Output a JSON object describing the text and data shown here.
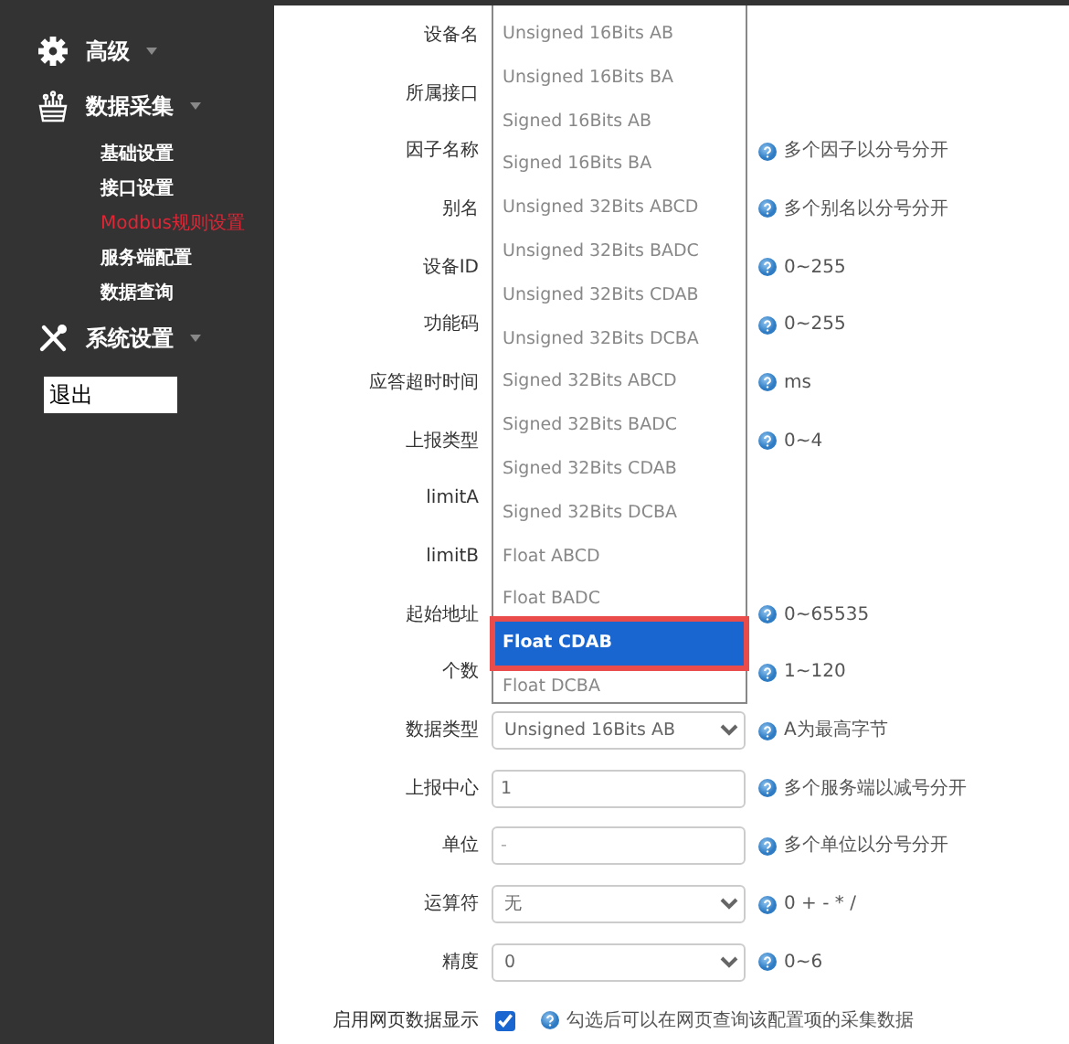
{
  "sidebar": {
    "items": [
      {
        "label": "高级",
        "kind": "gear"
      },
      {
        "label": "数据采集",
        "kind": "basket",
        "children": [
          {
            "label": "基础设置",
            "selected": false
          },
          {
            "label": "接口设置",
            "selected": false
          },
          {
            "label": "Modbus规则设置",
            "selected": true
          },
          {
            "label": "服务端配置",
            "selected": false
          },
          {
            "label": "数据查询",
            "selected": false
          }
        ]
      },
      {
        "label": "系统设置",
        "kind": "tools"
      }
    ],
    "logout": "退出"
  },
  "form": {
    "rows": [
      {
        "label": "设备名"
      },
      {
        "label": "所属接口"
      },
      {
        "label": "因子名称",
        "help": "多个因子以分号分开"
      },
      {
        "label": "别名",
        "help": "多个别名以分号分开"
      },
      {
        "label": "设备ID",
        "help": "0~255"
      },
      {
        "label": "功能码",
        "help": "0~255"
      },
      {
        "label": "应答超时时间",
        "help": "ms"
      },
      {
        "label": "上报类型",
        "help": "0~4"
      },
      {
        "label": "limitA"
      },
      {
        "label": "limitB"
      },
      {
        "label": "起始地址",
        "help": "0~65535"
      },
      {
        "label": "个数",
        "help": "1~120"
      },
      {
        "label": "数据类型",
        "field": {
          "kind": "select",
          "value": "Unsigned 16Bits AB"
        },
        "help": "A为最高字节"
      },
      {
        "label": "上报中心",
        "field": {
          "kind": "text",
          "value": "1"
        },
        "help": "多个服务端以减号分开"
      },
      {
        "label": "单位",
        "field": {
          "kind": "text",
          "placeholder": "-"
        },
        "help": "多个单位以分号分开"
      },
      {
        "label": "运算符",
        "field": {
          "kind": "select",
          "value": "无"
        },
        "help": "0 + - * /"
      },
      {
        "label": "精度",
        "field": {
          "kind": "select",
          "value": "0"
        },
        "help": "0~6"
      },
      {
        "label": "启用网页数据显示",
        "field": {
          "kind": "checkbox",
          "checked": true
        },
        "help": "勾选后可以在网页查询该配置项的采集数据"
      }
    ]
  },
  "dropdown": {
    "options": [
      {
        "label": "Unsigned 16Bits AB",
        "selected": false
      },
      {
        "label": "Unsigned 16Bits BA",
        "selected": false
      },
      {
        "label": "Signed 16Bits AB",
        "selected": false
      },
      {
        "label": "Signed 16Bits BA",
        "selected": false
      },
      {
        "label": "Unsigned 32Bits ABCD",
        "selected": false
      },
      {
        "label": "Unsigned 32Bits BADC",
        "selected": false
      },
      {
        "label": "Unsigned 32Bits CDAB",
        "selected": false
      },
      {
        "label": "Unsigned 32Bits DCBA",
        "selected": false
      },
      {
        "label": "Signed 32Bits ABCD",
        "selected": false
      },
      {
        "label": "Signed 32Bits BADC",
        "selected": false
      },
      {
        "label": "Signed 32Bits CDAB",
        "selected": false
      },
      {
        "label": "Signed 32Bits DCBA",
        "selected": false
      },
      {
        "label": "Float ABCD",
        "selected": false
      },
      {
        "label": "Float BADC",
        "selected": false
      },
      {
        "label": "Float CDAB",
        "selected": true
      },
      {
        "label": "Float DCBA",
        "selected": false
      }
    ]
  }
}
